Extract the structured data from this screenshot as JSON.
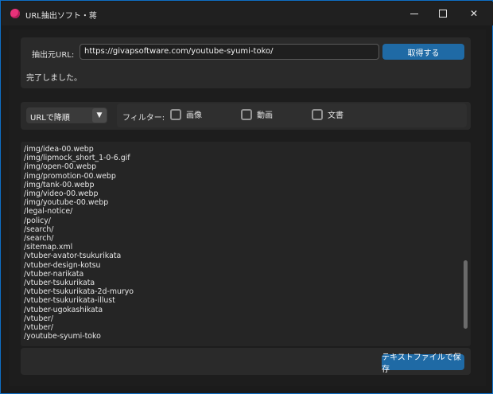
{
  "window": {
    "title": "URL抽出ソフト・蒋"
  },
  "top": {
    "url_label": "抽出元URL:",
    "url_value": "https://givapsoftware.com/youtube-syumi-toko/",
    "fetch_button": "取得する",
    "status": "完了しました。"
  },
  "filter": {
    "sort_selected": "URLで降順",
    "label": "フィルター:",
    "options": [
      {
        "label": "画像",
        "checked": false
      },
      {
        "label": "動画",
        "checked": false
      },
      {
        "label": "文書",
        "checked": false
      }
    ]
  },
  "results": [
    "/img/idea-00.webp",
    "/img/lipmock_short_1-0-6.gif",
    "/img/open-00.webp",
    "/img/promotion-00.webp",
    "/img/tank-00.webp",
    "/img/video-00.webp",
    "/img/youtube-00.webp",
    "/legal-notice/",
    "/policy/",
    "/search/",
    "/search/",
    "/sitemap.xml",
    "/vtuber-avator-tsukurikata",
    "/vtuber-design-kotsu",
    "/vtuber-narikata",
    "/vtuber-tsukurikata",
    "/vtuber-tsukurikata-2d-muryo",
    "/vtuber-tsukurikata-illust",
    "/vtuber-ugokashikata",
    "/vtuber/",
    "/vtuber/",
    "/youtube-syumi-toko"
  ],
  "bottom": {
    "save_button": "テキストファイルで保存"
  },
  "colors": {
    "accent": "#1f6aa5",
    "window_border": "#0e6fc5",
    "app_icon": "#e8327a"
  }
}
